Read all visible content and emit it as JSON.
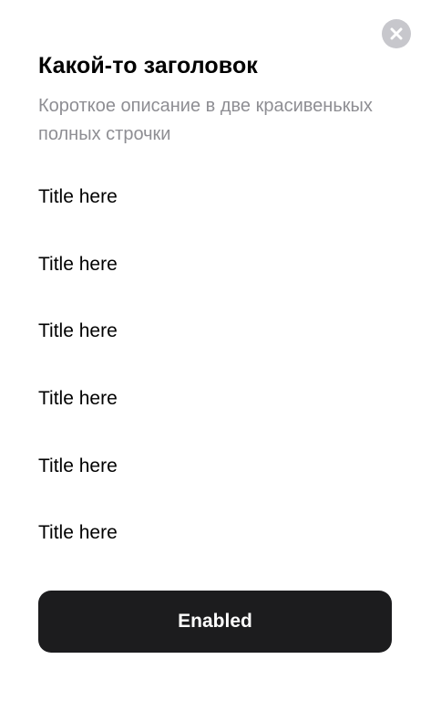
{
  "sheet": {
    "close_icon": "close-icon",
    "title": "Какой-то заголовок",
    "subtitle": "Короткое описание в две красивенькых полных строчки",
    "items": [
      {
        "label": "Title here"
      },
      {
        "label": "Title here"
      },
      {
        "label": "Title here"
      },
      {
        "label": "Title here"
      },
      {
        "label": "Title here"
      },
      {
        "label": "Title here"
      }
    ],
    "primary_button": {
      "label": "Enabled"
    }
  },
  "colors": {
    "background": "#ffffff",
    "text_primary": "#000000",
    "text_secondary": "#8e8e93",
    "close_button_bg": "#c7c7cc",
    "button_bg": "#1c1c1e",
    "button_text": "#ffffff"
  }
}
